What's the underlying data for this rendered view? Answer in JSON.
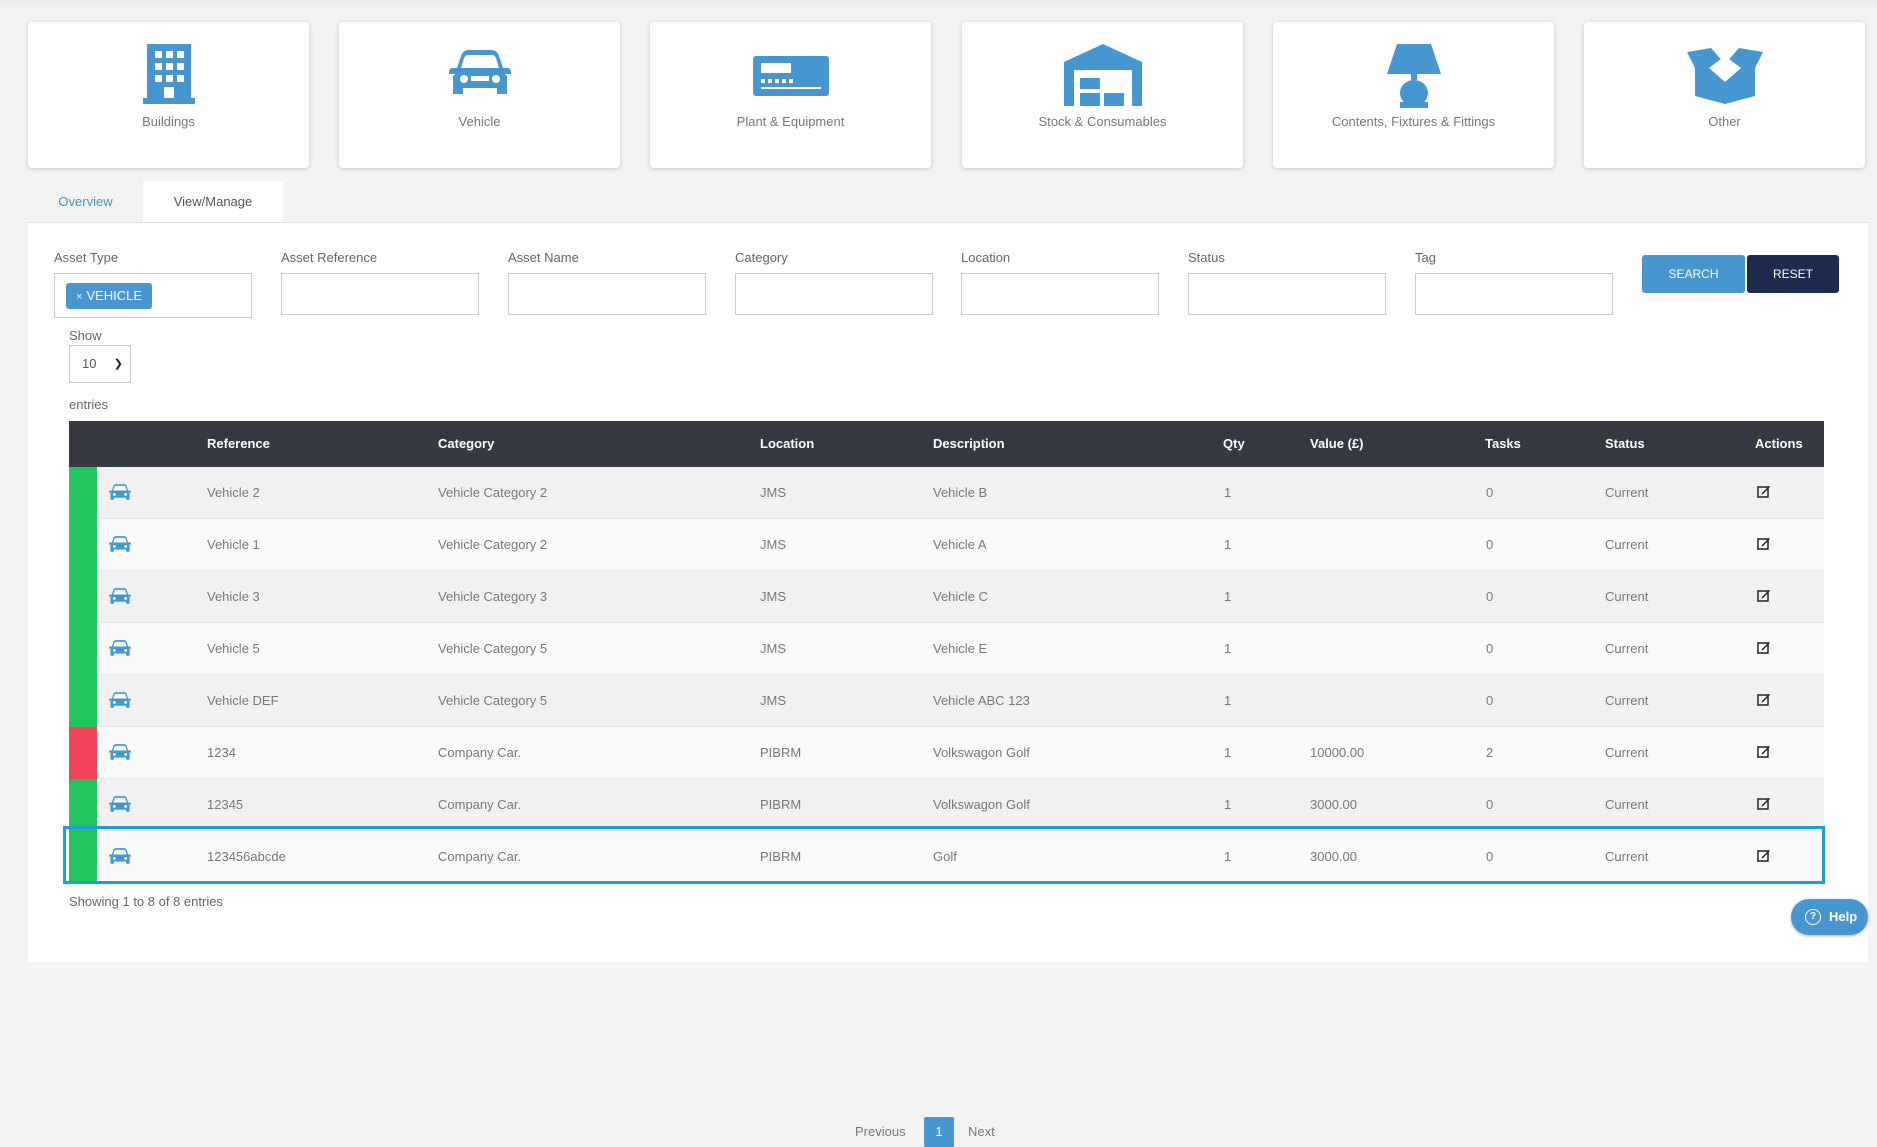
{
  "cards": [
    {
      "label": "Buildings",
      "icon": "building-icon"
    },
    {
      "label": "Vehicle",
      "icon": "car-icon"
    },
    {
      "label": "Plant & Equipment",
      "icon": "machine-icon"
    },
    {
      "label": "Stock & Consumables",
      "icon": "warehouse-icon"
    },
    {
      "label": "Contents, Fixtures & Fittings",
      "icon": "lamp-icon"
    },
    {
      "label": "Other",
      "icon": "open-box-icon"
    }
  ],
  "tabs": {
    "overview": "Overview",
    "manage": "View/Manage"
  },
  "filters": {
    "asset_type": {
      "label": "Asset Type",
      "chip": "VEHICLE",
      "chip_remove": "×"
    },
    "asset_reference": {
      "label": "Asset Reference",
      "value": ""
    },
    "asset_name": {
      "label": "Asset Name",
      "value": ""
    },
    "category": {
      "label": "Category",
      "value": ""
    },
    "location": {
      "label": "Location",
      "value": ""
    },
    "status": {
      "label": "Status",
      "value": ""
    },
    "tag": {
      "label": "Tag",
      "value": ""
    }
  },
  "buttons": {
    "search": "SEARCH",
    "reset": "RESET"
  },
  "show": {
    "label": "Show",
    "value": "10",
    "suffix": "entries"
  },
  "table": {
    "headers": {
      "reference": "Reference",
      "category": "Category",
      "location": "Location",
      "description": "Description",
      "qty": "Qty",
      "value": "Value (£)",
      "tasks": "Tasks",
      "status": "Status",
      "actions": "Actions"
    },
    "rows": [
      {
        "status_color": "#22c55e",
        "reference": "Vehicle 2",
        "category": "Vehicle Category 2",
        "location": "JMS",
        "description": "Vehicle B",
        "qty": "1",
        "value": "",
        "tasks": "0",
        "status": "Current"
      },
      {
        "status_color": "#22c55e",
        "reference": "Vehicle 1",
        "category": "Vehicle Category 2",
        "location": "JMS",
        "description": "Vehicle A",
        "qty": "1",
        "value": "",
        "tasks": "0",
        "status": "Current"
      },
      {
        "status_color": "#22c55e",
        "reference": "Vehicle 3",
        "category": "Vehicle Category 3",
        "location": "JMS",
        "description": "Vehicle C",
        "qty": "1",
        "value": "",
        "tasks": "0",
        "status": "Current"
      },
      {
        "status_color": "#22c55e",
        "reference": "Vehicle 5",
        "category": "Vehicle Category 5",
        "location": "JMS",
        "description": "Vehicle E",
        "qty": "1",
        "value": "",
        "tasks": "0",
        "status": "Current"
      },
      {
        "status_color": "#22c55e",
        "reference": "Vehicle DEF",
        "category": "Vehicle Category 5",
        "location": "JMS",
        "description": "Vehicle ABC 123",
        "qty": "1",
        "value": "",
        "tasks": "0",
        "status": "Current"
      },
      {
        "status_color": "#f0435a",
        "reference": "1234",
        "category": "Company Car.",
        "location": "PIBRM",
        "description": "Volkswagon Golf",
        "qty": "1",
        "value": "10000.00",
        "tasks": "2",
        "status": "Current"
      },
      {
        "status_color": "#22c55e",
        "reference": "12345",
        "category": "Company Car.",
        "location": "PIBRM",
        "description": "Volkswagon Golf",
        "qty": "1",
        "value": "3000.00",
        "tasks": "0",
        "status": "Current"
      },
      {
        "status_color": "#22c55e",
        "reference": "123456abcde",
        "category": "Company Car.",
        "location": "PIBRM",
        "description": "Golf",
        "qty": "1",
        "value": "3000.00",
        "tasks": "0",
        "status": "Current"
      }
    ]
  },
  "footer": {
    "info": "Showing 1 to 8 of 8 entries",
    "previous": "Previous",
    "page": "1",
    "next": "Next"
  },
  "help": {
    "label": "Help",
    "glyph": "?"
  },
  "colors": {
    "accent": "#4796d0",
    "dark": "#1d2b4f",
    "header": "#343a40",
    "highlight": "#1a9fd9"
  }
}
